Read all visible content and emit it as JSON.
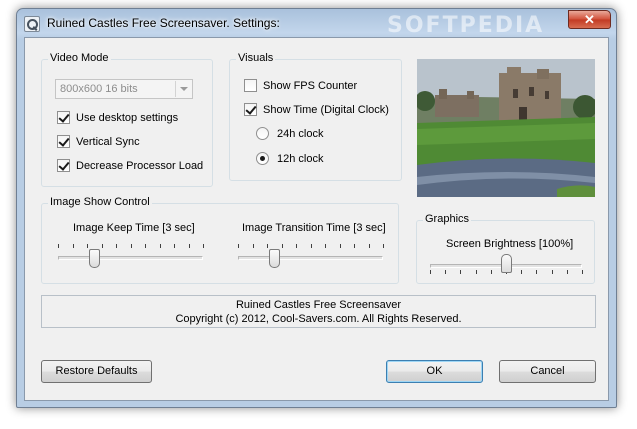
{
  "window": {
    "title": "Ruined Castles Free Screensaver. Settings:",
    "watermark": "SOFTPEDIA",
    "close_glyph": "✕"
  },
  "video_mode": {
    "legend": "Video Mode",
    "resolution": "800x600 16 bits",
    "use_desktop_settings": {
      "label": "Use desktop settings",
      "checked": true
    },
    "vertical_sync": {
      "label": "Vertical Sync",
      "checked": true
    },
    "decrease_processor_load": {
      "label": "Decrease Processor Load",
      "checked": true
    }
  },
  "visuals": {
    "legend": "Visuals",
    "show_fps_counter": {
      "label": "Show FPS Counter",
      "checked": false
    },
    "show_time": {
      "label": "Show Time (Digital Clock)",
      "checked": true
    },
    "clock_24h": {
      "label": "24h clock",
      "selected": false
    },
    "clock_12h": {
      "label": "12h clock",
      "selected": true
    }
  },
  "image_show_control": {
    "legend": "Image Show Control",
    "keep_time": {
      "label": "Image Keep Time [3 sec]",
      "value": 3,
      "fraction": 0.25,
      "ticks": 11
    },
    "transition_time": {
      "label": "Image Transition Time [3 sec]",
      "value": 3,
      "fraction": 0.25,
      "ticks": 11
    }
  },
  "graphics": {
    "legend": "Graphics",
    "brightness": {
      "label": "Screen Brightness [100%]",
      "value": 100,
      "fraction": 0.5,
      "ticks": 11
    }
  },
  "preview": {
    "icon": "castle-landscape-image"
  },
  "info": {
    "line1": "Ruined Castles Free Screensaver",
    "line2": "Copyright (c) 2012, Cool-Savers.com. All Rights Reserved."
  },
  "buttons": {
    "restore_defaults": "Restore Defaults",
    "ok": "OK",
    "cancel": "Cancel"
  }
}
